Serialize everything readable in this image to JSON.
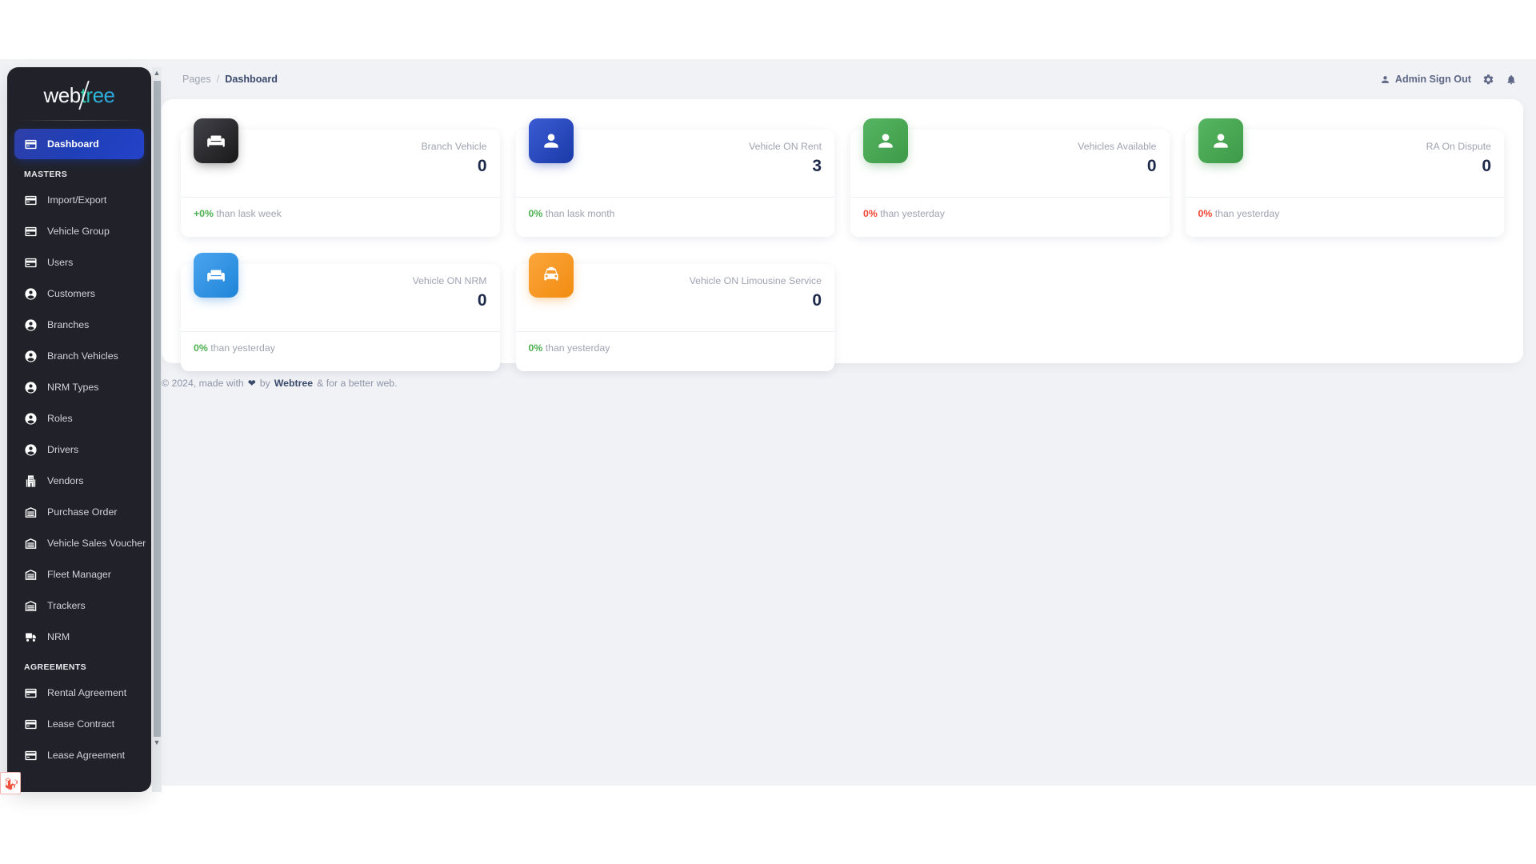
{
  "brand": {
    "part1": "web",
    "part2": "tree"
  },
  "sidebar": {
    "dashboard": {
      "label": "Dashboard",
      "icon": "credit-card-icon"
    },
    "sections": [
      {
        "title": "MASTERS",
        "items": [
          {
            "label": "Import/Export",
            "icon": "credit-card-icon"
          },
          {
            "label": "Vehicle Group",
            "icon": "credit-card-icon"
          },
          {
            "label": "Users",
            "icon": "credit-card-icon"
          },
          {
            "label": "Customers",
            "icon": "account-circle-icon"
          },
          {
            "label": "Branches",
            "icon": "account-circle-icon"
          },
          {
            "label": "Branch Vehicles",
            "icon": "account-circle-icon"
          },
          {
            "label": "NRM Types",
            "icon": "account-circle-icon"
          },
          {
            "label": "Roles",
            "icon": "account-circle-icon"
          },
          {
            "label": "Drivers",
            "icon": "account-circle-icon"
          },
          {
            "label": "Vendors",
            "icon": "building-icon"
          },
          {
            "label": "Purchase Order",
            "icon": "warehouse-icon"
          },
          {
            "label": "Vehicle Sales Voucher",
            "icon": "warehouse-icon"
          },
          {
            "label": "Fleet Manager",
            "icon": "warehouse-icon"
          },
          {
            "label": "Trackers",
            "icon": "warehouse-icon"
          },
          {
            "label": "NRM",
            "icon": "truck-icon"
          }
        ]
      },
      {
        "title": "AGREEMENTS",
        "items": [
          {
            "label": "Rental Agreement",
            "icon": "credit-card-icon"
          },
          {
            "label": "Lease Contract",
            "icon": "credit-card-icon"
          },
          {
            "label": "Lease Agreement",
            "icon": "credit-card-icon"
          }
        ]
      }
    ]
  },
  "topbar": {
    "breadcrumb_parent": "Pages",
    "breadcrumb_sep": "/",
    "breadcrumb_current": "Dashboard",
    "signout_label": "Admin Sign Out",
    "icons": [
      "person-icon",
      "gear-icon",
      "bell-icon"
    ]
  },
  "cards": [
    {
      "label": "Branch Vehicle",
      "value": "0",
      "pct": "+0%",
      "pct_tone": "pos",
      "note": "than lask week",
      "icon": "weekend-sofa-icon",
      "icon_style": "ic-dark"
    },
    {
      "label": "Vehicle ON Rent",
      "value": "3",
      "pct": "0%",
      "pct_tone": "pos",
      "note": "than lask month",
      "icon": "person-icon",
      "icon_style": "ic-blue"
    },
    {
      "label": "Vehicles Available",
      "value": "0",
      "pct": "0%",
      "pct_tone": "neg",
      "note": "than yesterday",
      "icon": "person-icon",
      "icon_style": "ic-green"
    },
    {
      "label": "RA On Dispute",
      "value": "0",
      "pct": "0%",
      "pct_tone": "neg",
      "note": "than yesterday",
      "icon": "person-icon",
      "icon_style": "ic-green"
    },
    {
      "label": "Vehicle ON NRM",
      "value": "0",
      "pct": "0%",
      "pct_tone": "pos",
      "note": "than yesterday",
      "icon": "weekend-sofa-icon",
      "icon_style": "ic-lblue"
    },
    {
      "label": "Vehicle ON Limousine Service",
      "value": "0",
      "pct": "0%",
      "pct_tone": "pos",
      "note": "than yesterday",
      "icon": "taxi-icon",
      "icon_style": "ic-orange"
    }
  ],
  "footer": {
    "copyright": "© 2024, made with",
    "by": "by",
    "brand": "Webtree",
    "tail": "& for a better web."
  },
  "colors": {
    "sidebar_bg": "#212229",
    "active_nav": "#1f3fb8",
    "page_bg": "#f0f2f5",
    "positive": "#4caf50",
    "negative": "#f44335",
    "value_text": "#1e2a4a"
  }
}
